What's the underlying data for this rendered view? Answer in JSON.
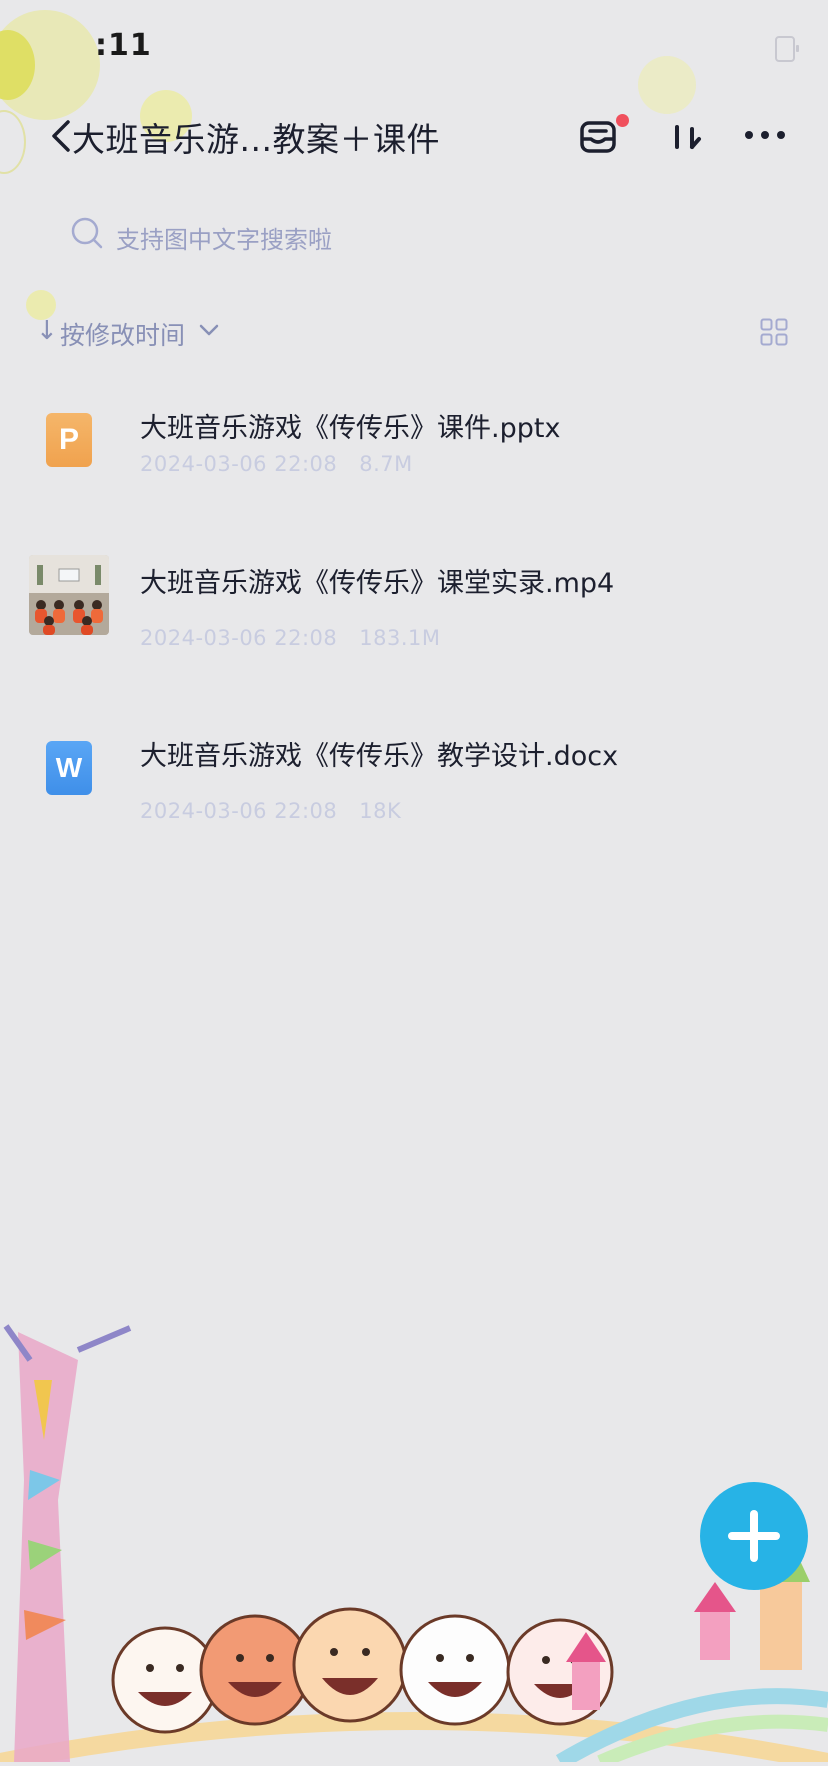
{
  "status_bar": {
    "time": ":11"
  },
  "header": {
    "title": "大班音乐游...教案＋课件",
    "icons": [
      "back-icon",
      "inbox-icon",
      "transfer-icon",
      "more-icon"
    ],
    "badge_color": "#f0505d"
  },
  "search": {
    "placeholder": "支持图中文字搜索啦"
  },
  "sort": {
    "arrow": "↓",
    "label": "按修改时间"
  },
  "files": [
    {
      "name": "大班音乐游戏《传传乐》课件.pptx",
      "date": "2024-03-06 22:08",
      "size": "8.7M",
      "icon": "ppt-icon",
      "icon_letter": "P"
    },
    {
      "name": "大班音乐游戏《传传乐》课堂实录.mp4",
      "date": "2024-03-06 22:08",
      "size": "183.1M",
      "icon": "video-thumbnail"
    },
    {
      "name": "大班音乐游戏《传传乐》教学设计.docx",
      "date": "2024-03-06 22:08",
      "size": "18K",
      "icon": "word-icon",
      "icon_letter": "W"
    }
  ],
  "fab": {
    "icon": "plus-icon",
    "color": "#27b3e6"
  },
  "colors": {
    "background": "#e8e8ea",
    "accent_text": "#8890b6",
    "meta_text": "#c8cce0"
  }
}
